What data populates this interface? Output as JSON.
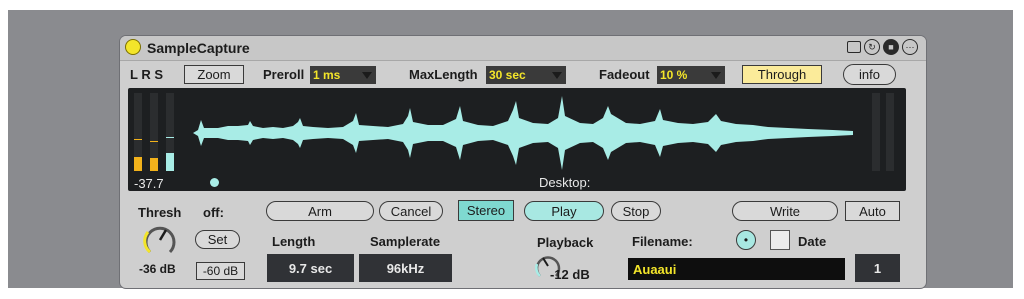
{
  "device": {
    "title": "SampleCapture",
    "titlebar_icons": [
      "panel-icon",
      "sync-icon",
      "save-icon",
      "more-icon"
    ]
  },
  "top_row": {
    "lrs": "L R S",
    "zoom": "Zoom",
    "preroll_label": "Preroll",
    "preroll_value": "1 ms",
    "maxlength_label": "MaxLength",
    "maxlength_value": "30 sec",
    "fadeout_label": "Fadeout",
    "fadeout_value": "10 %",
    "through": "Through",
    "info": "info"
  },
  "display": {
    "level": "-37.7",
    "source": "Desktop:"
  },
  "controls": {
    "thresh_label": "Thresh",
    "thresh_value": "-36 dB",
    "off_label": "off:",
    "set": "Set",
    "set_value": "-60 dB",
    "arm": "Arm",
    "cancel": "Cancel",
    "stereo": "Stereo",
    "play": "Play",
    "stop": "Stop",
    "write": "Write",
    "auto": "Auto",
    "length_label": "Length",
    "length_value": "9.7 sec",
    "samplerate_label": "Samplerate",
    "samplerate_value": "96kHz",
    "playback_label": "Playback",
    "playback_value": "-12 dB",
    "filename_label": "Filename:",
    "filename_value": "Auaaui",
    "date_label": "Date",
    "number": "1"
  },
  "colors": {
    "accent_yellow": "#f3e52a",
    "waveform_cyan": "#a8ece6",
    "meter_orange": "#f2b21b"
  }
}
